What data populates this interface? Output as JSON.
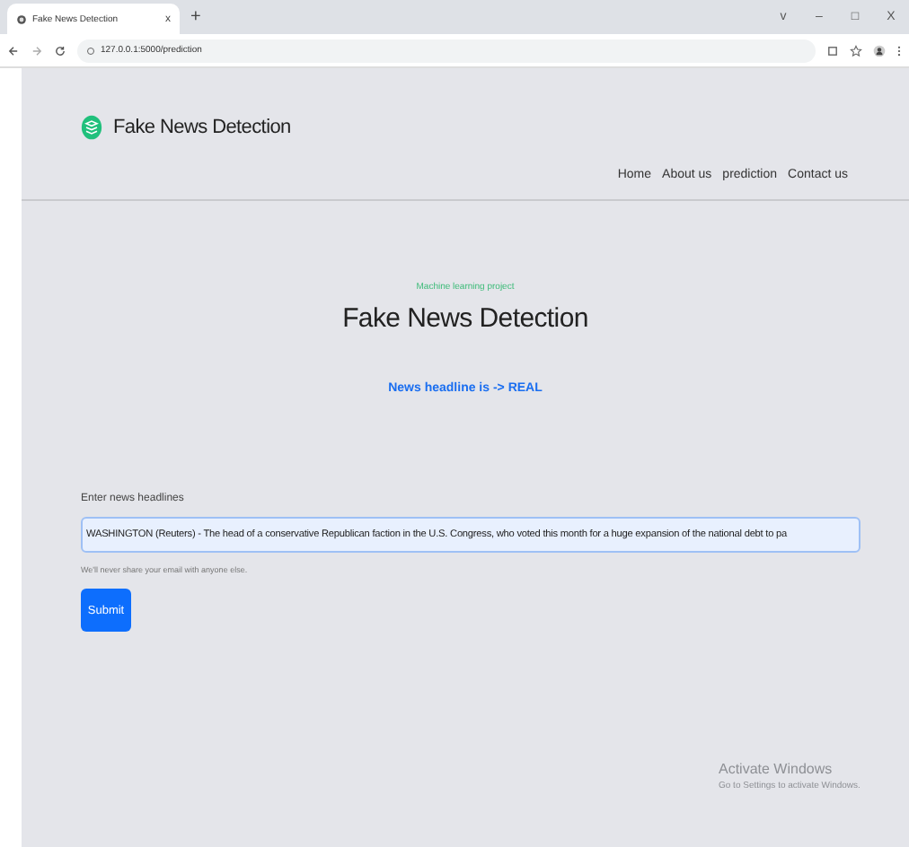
{
  "browser": {
    "tab_title": "Fake News Detection",
    "tab_close": "x",
    "new_tab": "+",
    "window_controls": [
      "v",
      "–",
      "□",
      "X"
    ],
    "url": "127.0.0.1:5000/prediction"
  },
  "navbar": {
    "brand": "Fake News Detection",
    "links": [
      {
        "label": "Home"
      },
      {
        "label": "About us"
      },
      {
        "label": "prediction"
      },
      {
        "label": "Contact us"
      }
    ]
  },
  "hero": {
    "subtitle": "Machine learning project",
    "title": "Fake News Detection",
    "result": "News headline is -> REAL"
  },
  "form": {
    "label": "Enter news headlines",
    "value": "WASHINGTON (Reuters) - The head of a conservative Republican faction in the U.S. Congress, who voted this month for a huge expansion of the national debt to pa",
    "help": "We'll never share your email with anyone else.",
    "button": "Submit"
  },
  "activation_notice": {
    "title": "Activate Windows",
    "text": "Go to Settings to activate Windows."
  }
}
